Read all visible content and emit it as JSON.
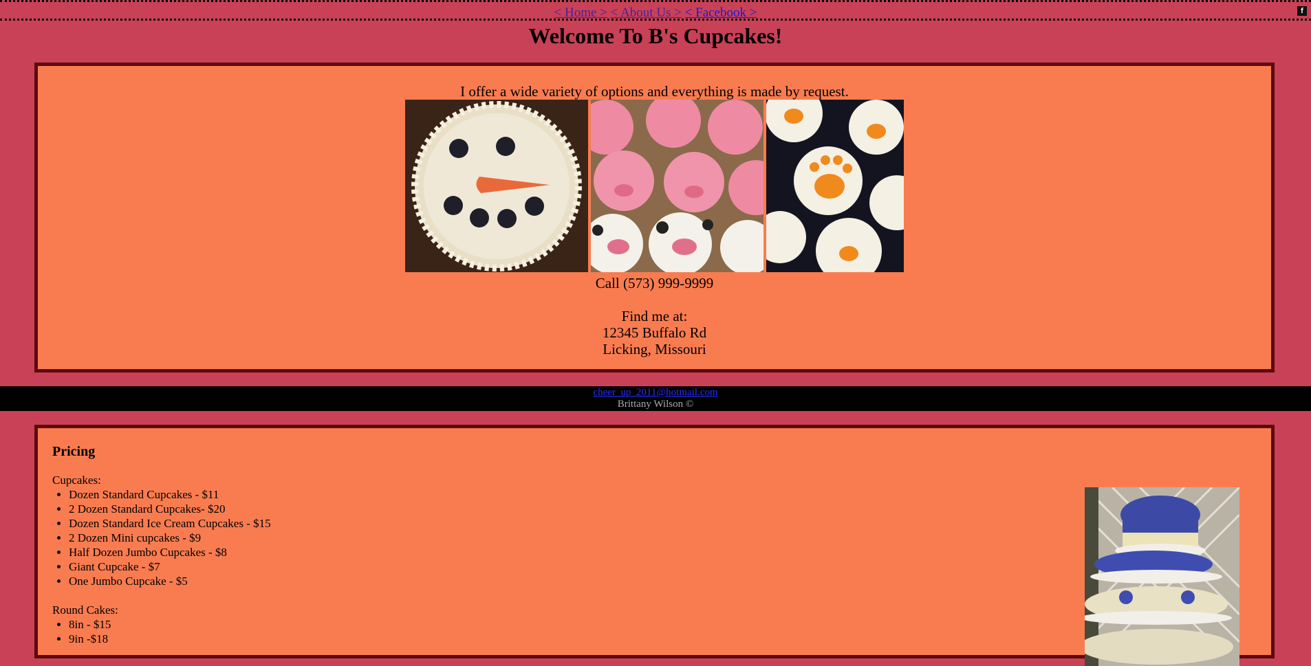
{
  "nav": {
    "home": "< Home >",
    "about": "< About Us >",
    "facebook": "< Facebook >",
    "facebook_icon": "f"
  },
  "header": {
    "title": "Welcome To B's Cupcakes!"
  },
  "intro": {
    "text": "I offer a wide variety of options and everything is made by request.",
    "photos": [
      {
        "name": "snowman-cake-photo"
      },
      {
        "name": "pig-cow-cupcakes-photo"
      },
      {
        "name": "paw-print-cupcakes-photo"
      }
    ]
  },
  "contact": {
    "phone": "Call (573) 999-9999",
    "find_label": "Find me at:",
    "street": "12345 Buffalo Rd",
    "city": "Licking, Missouri"
  },
  "footer": {
    "email": "cheer_up_2011@hotmail.com",
    "credit": "Brittany Wilson ©"
  },
  "pricing": {
    "heading": "Pricing",
    "cupcakes_label": "Cupcakes:",
    "cupcakes": [
      "Dozen Standard Cupcakes - $11",
      "2 Dozen Standard Cupcakes- $20",
      "Dozen Standard Ice Cream Cupcakes - $15",
      "2 Dozen Mini cupcakes - $9",
      "Half Dozen Jumbo Cupcakes - $8",
      "Giant Cupcake - $7",
      "One Jumbo Cupcake - $5"
    ],
    "round_label": "Round Cakes:",
    "round": [
      "8in - $15",
      "9in -$18"
    ]
  },
  "colors": {
    "page_bg": "#c94157",
    "panel_bg": "#f97c50",
    "panel_border": "#5c0a0e",
    "footer_bg": "#000000"
  }
}
